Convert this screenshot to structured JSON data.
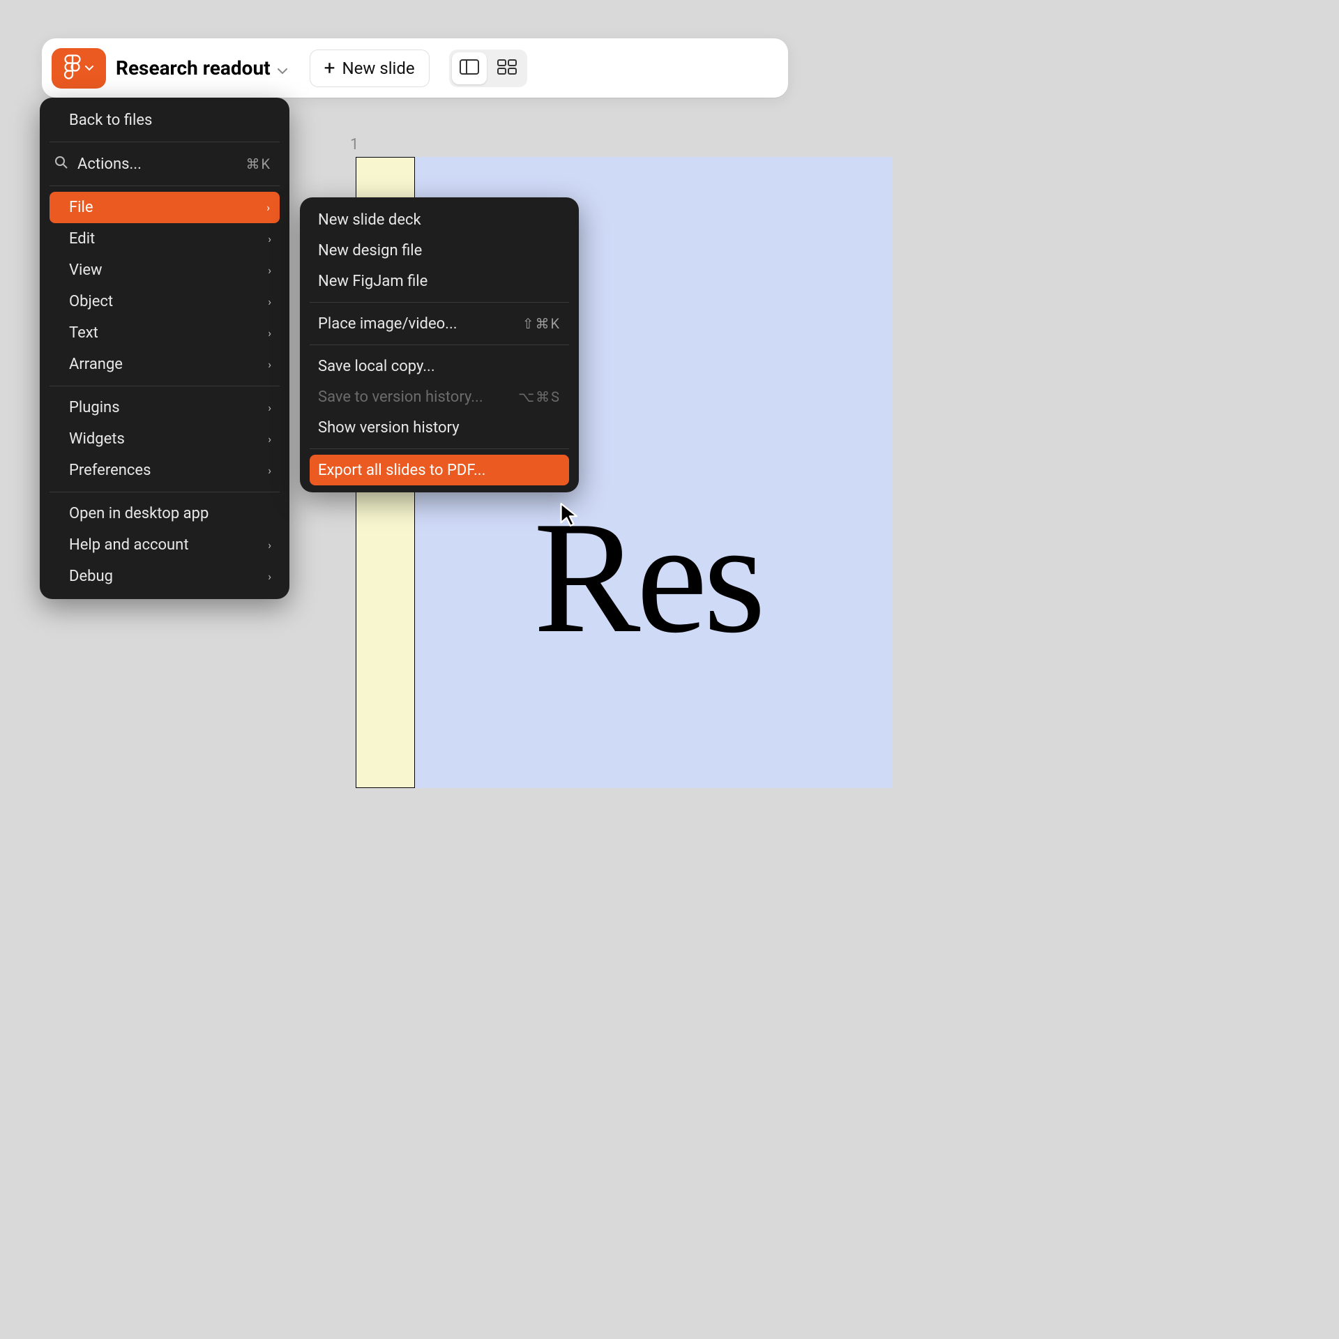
{
  "colors": {
    "accent": "#ea5a21",
    "menu_bg": "#1e1e1e"
  },
  "toolbar": {
    "doc_title": "Research readout",
    "new_slide_label": "New slide"
  },
  "canvas": {
    "slide_number": "1",
    "slide_text": "Res"
  },
  "menu": {
    "back": "Back to files",
    "actions_label": "Actions...",
    "actions_shortcut": "⌘K",
    "items": [
      {
        "label": "File",
        "active": true
      },
      {
        "label": "Edit"
      },
      {
        "label": "View"
      },
      {
        "label": "Object"
      },
      {
        "label": "Text"
      },
      {
        "label": "Arrange"
      }
    ],
    "group2": [
      {
        "label": "Plugins"
      },
      {
        "label": "Widgets"
      },
      {
        "label": "Preferences"
      }
    ],
    "group3": [
      {
        "label": "Open in desktop app",
        "no_arrow": true
      },
      {
        "label": "Help and account"
      },
      {
        "label": "Debug"
      }
    ]
  },
  "submenu": {
    "group1": [
      {
        "label": "New slide deck"
      },
      {
        "label": "New design file"
      },
      {
        "label": "New FigJam file"
      }
    ],
    "place": {
      "label": "Place image/video...",
      "shortcut": "⇧⌘K"
    },
    "group3": [
      {
        "label": "Save local copy..."
      },
      {
        "label": "Save to version history...",
        "shortcut": "⌥⌘S",
        "disabled": true
      },
      {
        "label": "Show version history"
      }
    ],
    "export": {
      "label": "Export all slides to PDF..."
    }
  }
}
